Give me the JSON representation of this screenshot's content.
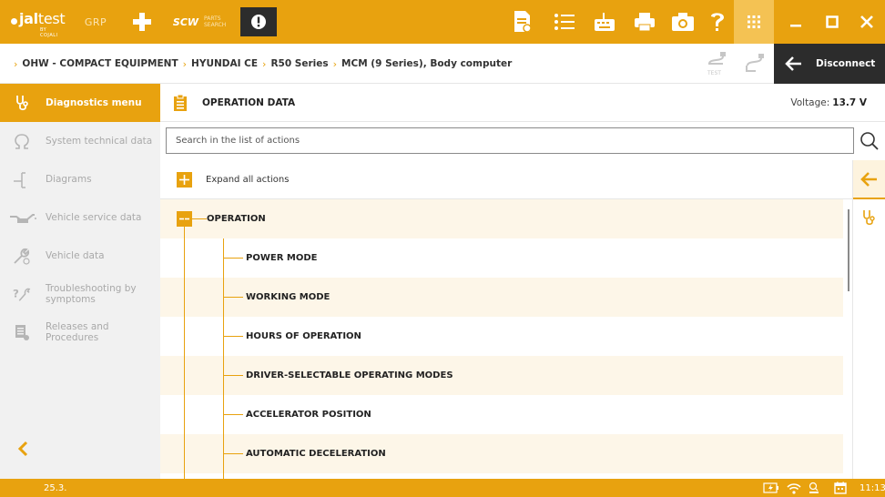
{
  "topbar": {
    "logo_text_1": "jal",
    "logo_text_2": "test",
    "logo_sub": "BY COJALI",
    "grp_label": "GRP",
    "scw_label": "SCW",
    "parts_label_1": "PARTS",
    "parts_label_2": "SEARCH",
    "accent_color": "#e8a20f",
    "icons": [
      "add-icon",
      "alert-icon",
      "report-icon",
      "list-icon",
      "keyboard-icon",
      "print-icon",
      "camera-icon",
      "help-icon",
      "apps-grid-icon",
      "minimize-icon",
      "maximize-icon",
      "close-icon"
    ]
  },
  "breadcrumb": {
    "items": [
      "OHW - COMPACT EQUIPMENT",
      "HYUNDAI CE",
      "R50 Series",
      "MCM (9 Series), Body computer"
    ],
    "disconnect_label": "Disconnect"
  },
  "sidebar": {
    "items": [
      {
        "label": "Diagnostics menu",
        "icon": "diagnostics-icon",
        "active": true
      },
      {
        "label": "System technical data",
        "icon": "ohm-icon",
        "active": false
      },
      {
        "label": "Diagrams",
        "icon": "diagram-icon",
        "active": false
      },
      {
        "label": "Vehicle service data",
        "icon": "oil-can-icon",
        "active": false
      },
      {
        "label": "Vehicle data",
        "icon": "wrench-icon",
        "active": false
      },
      {
        "label": "Troubleshooting by symptoms",
        "icon": "troubleshooting-icon",
        "active": false
      },
      {
        "label": "Releases and Procedures",
        "icon": "procedures-icon",
        "active": false
      }
    ]
  },
  "main": {
    "title": "OPERATION DATA",
    "voltage_label": "Voltage:",
    "voltage_value": "13.7 V",
    "search_placeholder": "Search in the list of actions",
    "expand_label": "Expand all actions",
    "tree": {
      "root_label": "OPERATION",
      "children": [
        "POWER MODE",
        "WORKING MODE",
        "HOURS OF OPERATION",
        "DRIVER-SELECTABLE OPERATING MODES",
        "ACCELERATOR POSITION",
        "AUTOMATIC DECELERATION"
      ]
    }
  },
  "status": {
    "version": "25.3.",
    "time": "11:13"
  }
}
